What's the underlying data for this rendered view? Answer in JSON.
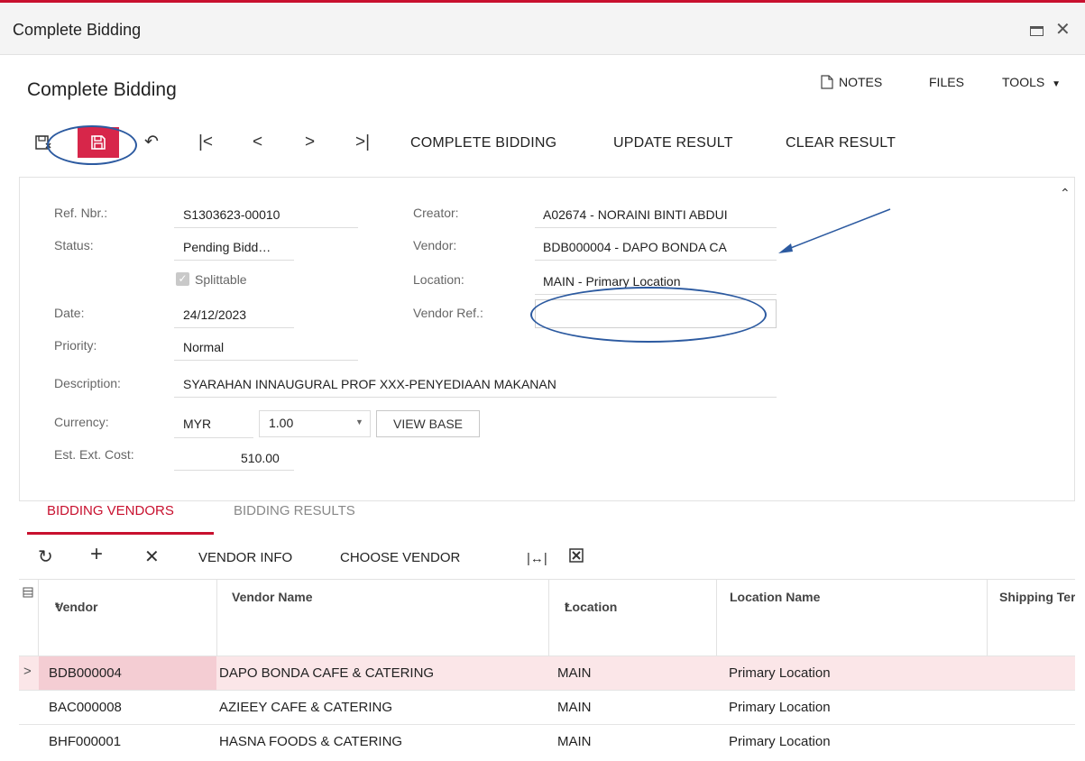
{
  "window": {
    "title": "Complete Bidding"
  },
  "page": {
    "title": "Complete Bidding"
  },
  "top_actions": {
    "notes": "NOTES",
    "files": "FILES",
    "tools": "TOOLS"
  },
  "toolbar": {
    "complete_bidding": "COMPLETE BIDDING",
    "update_result": "UPDATE RESULT",
    "clear_result": "CLEAR RESULT"
  },
  "form": {
    "ref_nbr": {
      "label": "Ref. Nbr.:",
      "value": "S1303623-00010"
    },
    "status": {
      "label": "Status:",
      "value": "Pending Bidd…"
    },
    "splittable": {
      "label": "Splittable",
      "checked": true
    },
    "date": {
      "label": "Date:",
      "value": "24/12/2023"
    },
    "priority": {
      "label": "Priority:",
      "value": "Normal"
    },
    "description": {
      "label": "Description:",
      "value": "SYARAHAN INNAUGURAL PROF XXX-PENYEDIAAN MAKANAN"
    },
    "currency": {
      "label": "Currency:",
      "value": "MYR",
      "rate": "1.00",
      "view_base": "VIEW BASE"
    },
    "est_ext_cost": {
      "label": "Est. Ext. Cost:",
      "value": "510.00"
    },
    "creator": {
      "label": "Creator:",
      "value": "A02674 - NORAINI BINTI ABDUI"
    },
    "vendor": {
      "label": "Vendor:",
      "value": "BDB000004 - DAPO BONDA CA"
    },
    "location": {
      "label": "Location:",
      "value": "MAIN - Primary Location"
    },
    "vendor_ref": {
      "label": "Vendor Ref.:",
      "value": ""
    }
  },
  "tabs": [
    {
      "label": "BIDDING VENDORS",
      "active": true
    },
    {
      "label": "BIDDING RESULTS",
      "active": false
    }
  ],
  "grid_toolbar": {
    "vendor_info": "VENDOR INFO",
    "choose_vendor": "CHOOSE VENDOR"
  },
  "grid": {
    "columns": {
      "vendor": "Vendor",
      "vendor_name": "Vendor Name",
      "location": "Location",
      "location_name": "Location Name",
      "shipping_terms": "Shipping Ter"
    },
    "required_marker": "*",
    "rows": [
      {
        "vendor": "BDB000004",
        "vendor_name": "DAPO BONDA CAFE & CATERING",
        "location": "MAIN",
        "location_name": "Primary Location"
      },
      {
        "vendor": "BAC000008",
        "vendor_name": "AZIEEY CAFE & CATERING",
        "location": "MAIN",
        "location_name": "Primary Location"
      },
      {
        "vendor": "BHF000001",
        "vendor_name": "HASNA FOODS & CATERING",
        "location": "MAIN",
        "location_name": "Primary Location"
      }
    ]
  },
  "colors": {
    "accent": "#c8102e",
    "save_button": "#d7264a",
    "annotation": "#2c5aa0",
    "selected_row": "#fbe6e8"
  }
}
